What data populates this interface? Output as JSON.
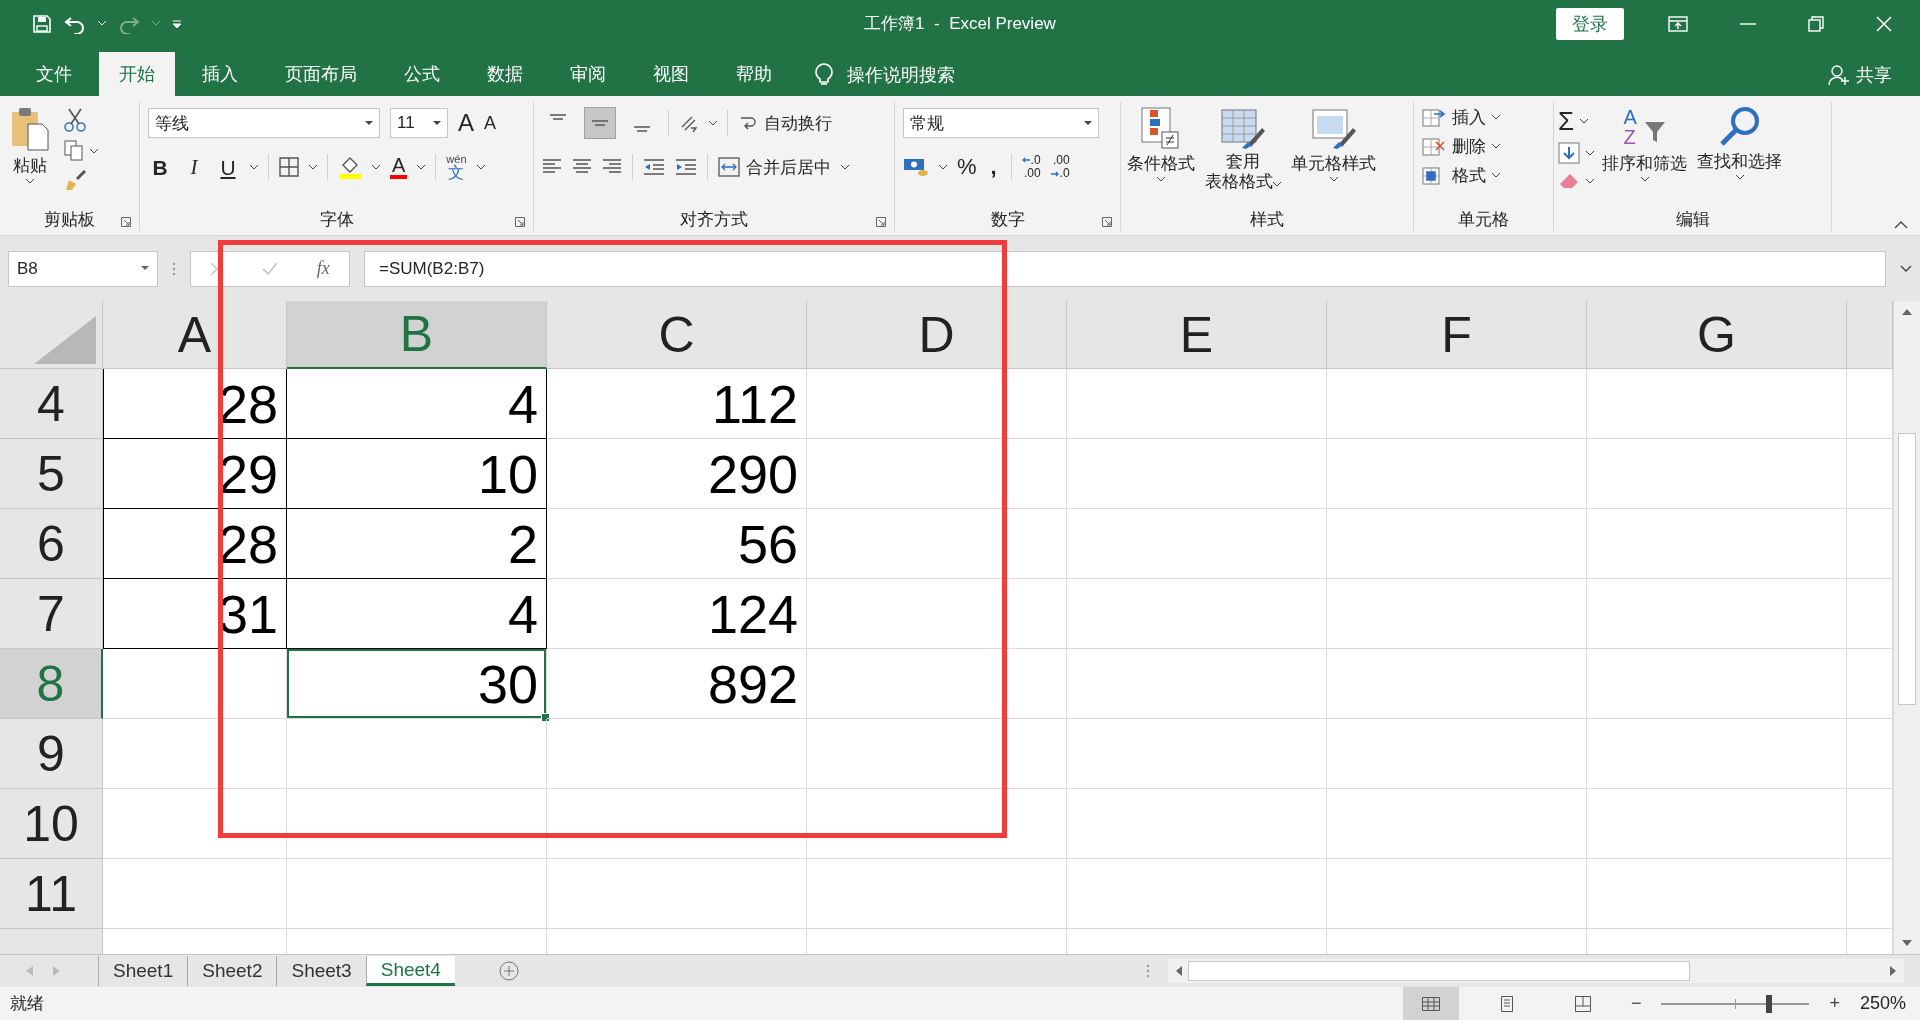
{
  "window": {
    "title": "工作簿1  -  Excel Preview",
    "sign_in": "登录"
  },
  "ribbon_tabs": [
    {
      "label": "文件",
      "selected": false
    },
    {
      "label": "开始",
      "selected": true
    },
    {
      "label": "插入",
      "selected": false
    },
    {
      "label": "页面布局",
      "selected": false
    },
    {
      "label": "公式",
      "selected": false
    },
    {
      "label": "数据",
      "selected": false
    },
    {
      "label": "审阅",
      "selected": false
    },
    {
      "label": "视图",
      "selected": false
    },
    {
      "label": "帮助",
      "selected": false
    }
  ],
  "tell_me": "操作说明搜索",
  "share": "共享",
  "clipboard": {
    "paste": "粘贴",
    "label": "剪贴板"
  },
  "font": {
    "name": "等线",
    "size": "11",
    "grow": "A",
    "shrink": "A",
    "styles": [
      "B",
      "I",
      "U"
    ],
    "color_letter": "A",
    "phonetic_top": "wén",
    "phonetic_bottom": "文",
    "label": "字体"
  },
  "alignment": {
    "vertical": [
      {
        "kind": "top",
        "selected": false
      },
      {
        "kind": "middle",
        "selected": true
      },
      {
        "kind": "bottom",
        "selected": false
      }
    ],
    "wrap": "自动换行",
    "merge": "合并后居中",
    "label": "对齐方式"
  },
  "number": {
    "format": "常规",
    "percent": "%",
    "comma": ",",
    "increase_decimal": [
      ".0",
      ".00"
    ],
    "decrease_decimal": [
      ".00",
      ".0"
    ],
    "label": "数字"
  },
  "styles": {
    "conditional": "条件格式",
    "table_lines": [
      "套用",
      "表格格式"
    ],
    "cell_styles": "单元格样式",
    "label": "样式"
  },
  "cells": {
    "items": [
      "插入",
      "删除",
      "格式"
    ],
    "label": "单元格"
  },
  "editing": {
    "sum": "Σ",
    "sort_letters": [
      "A",
      "Z"
    ],
    "sort": "排序和筛选",
    "find": "查找和选择",
    "label": "编辑"
  },
  "formula_bar": {
    "name_box": "B8",
    "fx": "fx",
    "formula": "=SUM(B2:B7)"
  },
  "columns": [
    {
      "label": "A",
      "selected": false
    },
    {
      "label": "B",
      "selected": true
    },
    {
      "label": "C",
      "selected": false
    },
    {
      "label": "D",
      "selected": false
    },
    {
      "label": "E",
      "selected": false
    },
    {
      "label": "F",
      "selected": false
    },
    {
      "label": "G",
      "selected": false
    }
  ],
  "rows": [
    {
      "header": "4",
      "selected": false,
      "cells": [
        {
          "text": "28",
          "bordered": true
        },
        {
          "text": "4",
          "bordered": true
        },
        {
          "text": "112",
          "bordered": false
        }
      ]
    },
    {
      "header": "5",
      "selected": false,
      "cells": [
        {
          "text": "29",
          "bordered": true
        },
        {
          "text": "10",
          "bordered": true
        },
        {
          "text": "290",
          "bordered": false
        }
      ]
    },
    {
      "header": "6",
      "selected": false,
      "cells": [
        {
          "text": "28",
          "bordered": true
        },
        {
          "text": "2",
          "bordered": true
        },
        {
          "text": "56",
          "bordered": false
        }
      ]
    },
    {
      "header": "7",
      "selected": false,
      "cells": [
        {
          "text": "31",
          "bordered": true
        },
        {
          "text": "4",
          "bordered": true
        },
        {
          "text": "124",
          "bordered": false
        }
      ]
    },
    {
      "header": "8",
      "selected": true,
      "cells": [
        {
          "text": "",
          "bordered": false
        },
        {
          "text": "30",
          "bordered": false
        },
        {
          "text": "892",
          "bordered": false
        }
      ]
    },
    {
      "header": "9",
      "selected": false,
      "cells": []
    },
    {
      "header": "10",
      "selected": false,
      "cells": []
    },
    {
      "header": "11",
      "selected": false,
      "cells": []
    }
  ],
  "sheet_tabs": [
    {
      "label": "Sheet1",
      "selected": false
    },
    {
      "label": "Sheet2",
      "selected": false
    },
    {
      "label": "Sheet3",
      "selected": false
    },
    {
      "label": "Sheet4",
      "selected": true
    }
  ],
  "status": "就绪",
  "views": [
    {
      "kind": "normal",
      "selected": true
    },
    {
      "kind": "page_layout",
      "selected": false
    },
    {
      "kind": "page_break",
      "selected": false
    }
  ],
  "zoom": {
    "minus": "−",
    "plus": "+",
    "level": 0.75,
    "reading": "250%"
  }
}
